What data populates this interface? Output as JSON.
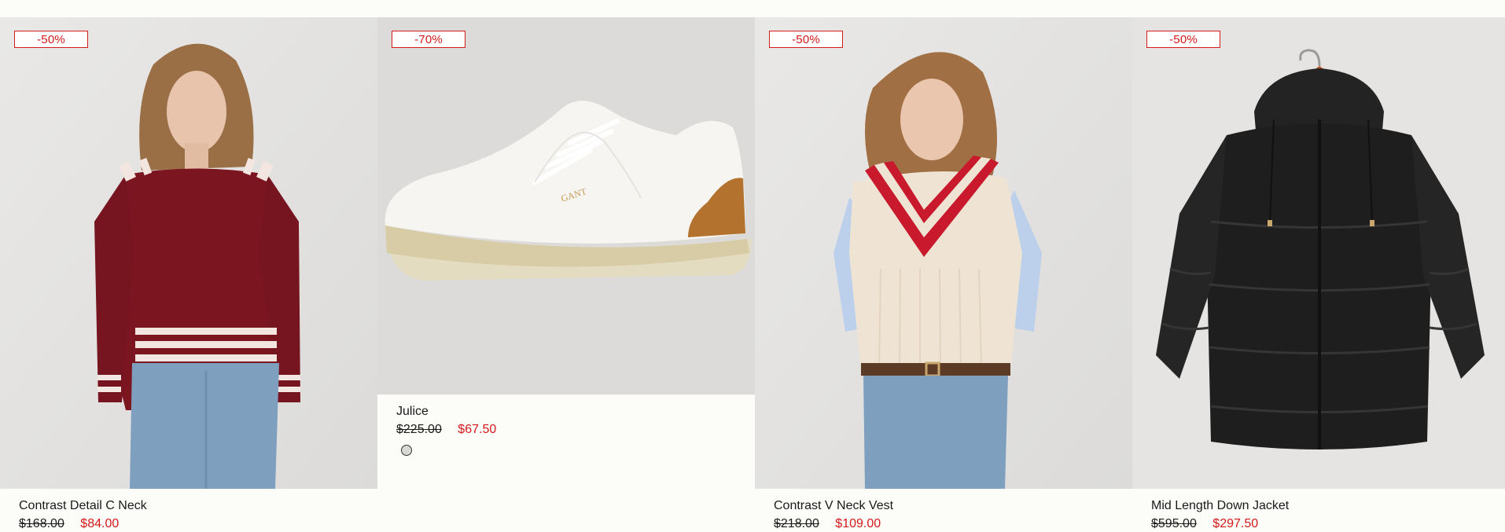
{
  "products": [
    {
      "discount": "-50%",
      "name": "Contrast Detail C Neck",
      "was_price": "$168.00",
      "now_price": "$84.00",
      "image": "model-red-sweater"
    },
    {
      "discount": "-70%",
      "name": "Julice",
      "was_price": "$225.00",
      "now_price": "$67.50",
      "image": "white-sneaker",
      "swatch_color": "#d9d8d2"
    },
    {
      "discount": "-50%",
      "name": "Contrast V Neck Vest",
      "was_price": "$218.00",
      "now_price": "$109.00",
      "image": "model-cricket-vest"
    },
    {
      "discount": "-50%",
      "name": "Mid Length Down Jacket",
      "was_price": "$595.00",
      "now_price": "$297.50",
      "image": "black-puffer-jacket"
    }
  ],
  "colors": {
    "sale_red": "#d51a1a",
    "background": "#fcfcf9",
    "image_bg": "#e6e5e3"
  }
}
